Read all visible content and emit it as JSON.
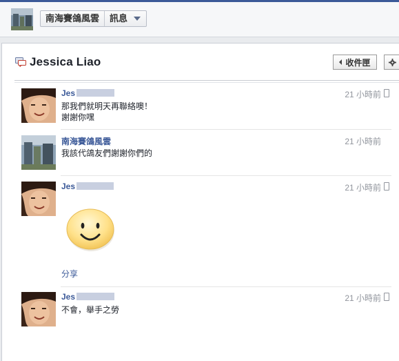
{
  "header": {
    "group_name": "南海賽鴿風雲",
    "section": "訊息"
  },
  "thread": {
    "title": "Jessica Liao",
    "inbox_label": "收件匣",
    "gear_icon": "gear-icon"
  },
  "messages": [
    {
      "sender": "Jes",
      "time": "21 小時前",
      "lines": [
        "那我們就明天再聯絡噢！",
        "謝謝你嘿"
      ]
    },
    {
      "sender": "南海賽鴿風雲",
      "time": "21 小時前",
      "lines": [
        "我該代鴿友們謝謝你們的"
      ]
    },
    {
      "sender": "Jes",
      "time": "21 小時前",
      "sticker": "smiley-sticker",
      "share": "分享"
    },
    {
      "sender": "Jes",
      "time": "21 小時前",
      "lines": [
        "不會，舉手之勞"
      ]
    }
  ],
  "colors": {
    "link": "#3b5998",
    "time": "#90949c",
    "brand": "#3b5998"
  }
}
